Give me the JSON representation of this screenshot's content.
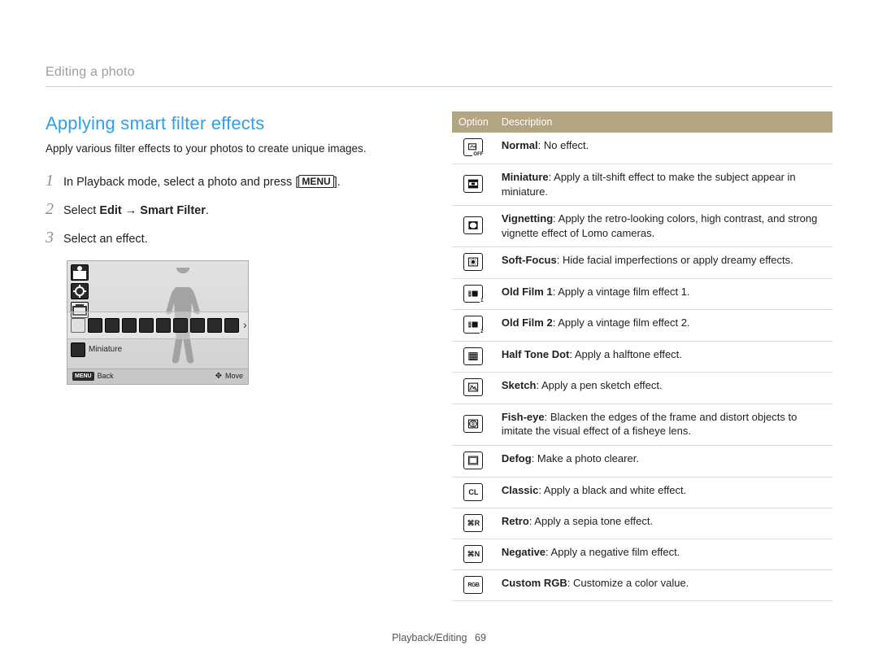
{
  "breadcrumb": "Editing a photo",
  "section_title": "Applying smart filter effects",
  "intro": "Apply various filter effects to your photos to create unique images.",
  "steps": {
    "s1_pre": "In Playback mode, select a photo and press [",
    "s1_key": "MENU",
    "s1_post": "].",
    "s2_pre": "Select ",
    "s2_bold": "Edit → Smart Filter",
    "s2_post": ".",
    "s3": "Select an effect."
  },
  "camera_screen": {
    "selected_label": "Miniature",
    "footer_back_key": "MENU",
    "footer_back": "Back",
    "footer_move": "Move"
  },
  "table_header": {
    "option": "Option",
    "description": "Description"
  },
  "options": [
    {
      "name": "Normal",
      "desc": "No effect."
    },
    {
      "name": "Miniature",
      "desc": "Apply a tilt-shift effect to make the subject appear in miniature."
    },
    {
      "name": "Vignetting",
      "desc": "Apply the retro-looking colors, high contrast, and strong vignette effect of Lomo cameras."
    },
    {
      "name": "Soft-Focus",
      "desc": "Hide facial imperfections or apply dreamy effects."
    },
    {
      "name": "Old Film 1",
      "desc": "Apply a vintage film effect 1."
    },
    {
      "name": "Old Film 2",
      "desc": "Apply a vintage film effect 2."
    },
    {
      "name": "Half Tone Dot",
      "desc": "Apply a halftone effect."
    },
    {
      "name": "Sketch",
      "desc": "Apply a pen sketch effect."
    },
    {
      "name": "Fish-eye",
      "desc": "Blacken the edges of the frame and distort objects to imitate the visual effect of a fisheye lens."
    },
    {
      "name": "Defog",
      "desc": "Make a photo clearer."
    },
    {
      "name": "Classic",
      "desc": "Apply a black and white effect."
    },
    {
      "name": "Retro",
      "desc": "Apply a sepia tone effect."
    },
    {
      "name": "Negative",
      "desc": "Apply a negative film effect."
    },
    {
      "name": "Custom RGB",
      "desc": "Customize a color value."
    }
  ],
  "icon_kinds": [
    "normal-off-icon",
    "miniature-icon",
    "vignetting-icon",
    "soft-focus-icon",
    "old-film-1-icon",
    "old-film-2-icon",
    "halftone-icon",
    "sketch-icon",
    "fisheye-icon",
    "defog-icon",
    "classic-icon",
    "retro-icon",
    "negative-icon",
    "rgb-icon"
  ],
  "footer": {
    "section": "Playback/Editing",
    "page": "69"
  }
}
